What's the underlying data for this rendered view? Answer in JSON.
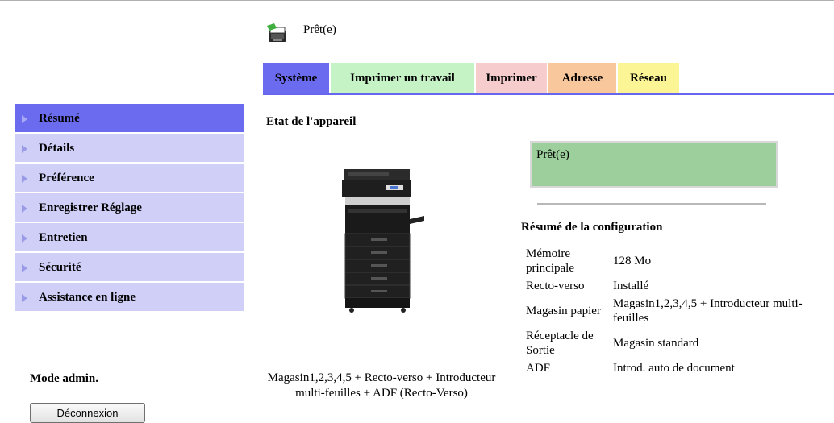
{
  "status": {
    "label": "Prêt(e)",
    "icon": "printer-icon"
  },
  "tabs": [
    {
      "label": "Système",
      "color": "#6b6bef"
    },
    {
      "label": "Imprimer un travail",
      "color": "#c6f3c6"
    },
    {
      "label": "Imprimer",
      "color": "#f6cccc"
    },
    {
      "label": "Adresse",
      "color": "#f8c79b"
    },
    {
      "label": "Réseau",
      "color": "#fbf596"
    }
  ],
  "sidebar": {
    "items": [
      {
        "label": "Résumé"
      },
      {
        "label": "Détails"
      },
      {
        "label": "Préférence"
      },
      {
        "label": "Enregistrer Réglage"
      },
      {
        "label": "Entretien"
      },
      {
        "label": "Sécurité"
      },
      {
        "label": "Assistance en ligne"
      }
    ],
    "admin_mode": "Mode admin.",
    "logout_label": "Déconnexion"
  },
  "main": {
    "section_title": "Etat de l'appareil",
    "device_caption": "Magasin1,2,3,4,5 + Recto-verso + Introducteur multi-feuilles + ADF (Recto-Verso)",
    "ready_status": "Prêt(e)",
    "config_title": "Résumé de la configuration",
    "config": [
      {
        "key": "Mémoire principale",
        "value": "128 Mo"
      },
      {
        "key": "Recto-verso",
        "value": "Installé"
      },
      {
        "key": "Magasin papier",
        "value": "Magasin1,2,3,4,5 + Introducteur multi-feuilles"
      },
      {
        "key": "Réceptacle de Sortie",
        "value": "Magasin standard"
      },
      {
        "key": "ADF",
        "value": "Introd. auto de document"
      }
    ]
  }
}
